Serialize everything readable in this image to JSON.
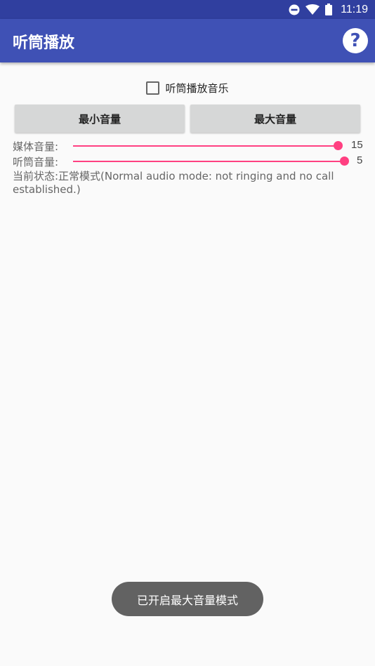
{
  "status_bar": {
    "time": "11:19"
  },
  "appbar": {
    "title": "听筒播放",
    "help_icon": "?"
  },
  "checkbox": {
    "label": "听筒播放音乐",
    "checked": false
  },
  "buttons": {
    "min_volume": "最小音量",
    "max_volume": "最大音量"
  },
  "media_volume": {
    "label": "媒体音量:",
    "value": "15",
    "level": 1.0
  },
  "earpiece_volume": {
    "label": "听筒音量:",
    "value": "5",
    "level": 1.0
  },
  "state": {
    "text": "当前状态:正常模式(Normal audio mode: not ringing and no call established.)"
  },
  "toast": {
    "text": "已开启最大音量模式"
  },
  "colors": {
    "primary": "#3f51b5",
    "primary_dark": "#303f9f",
    "accent": "#ff4081"
  }
}
